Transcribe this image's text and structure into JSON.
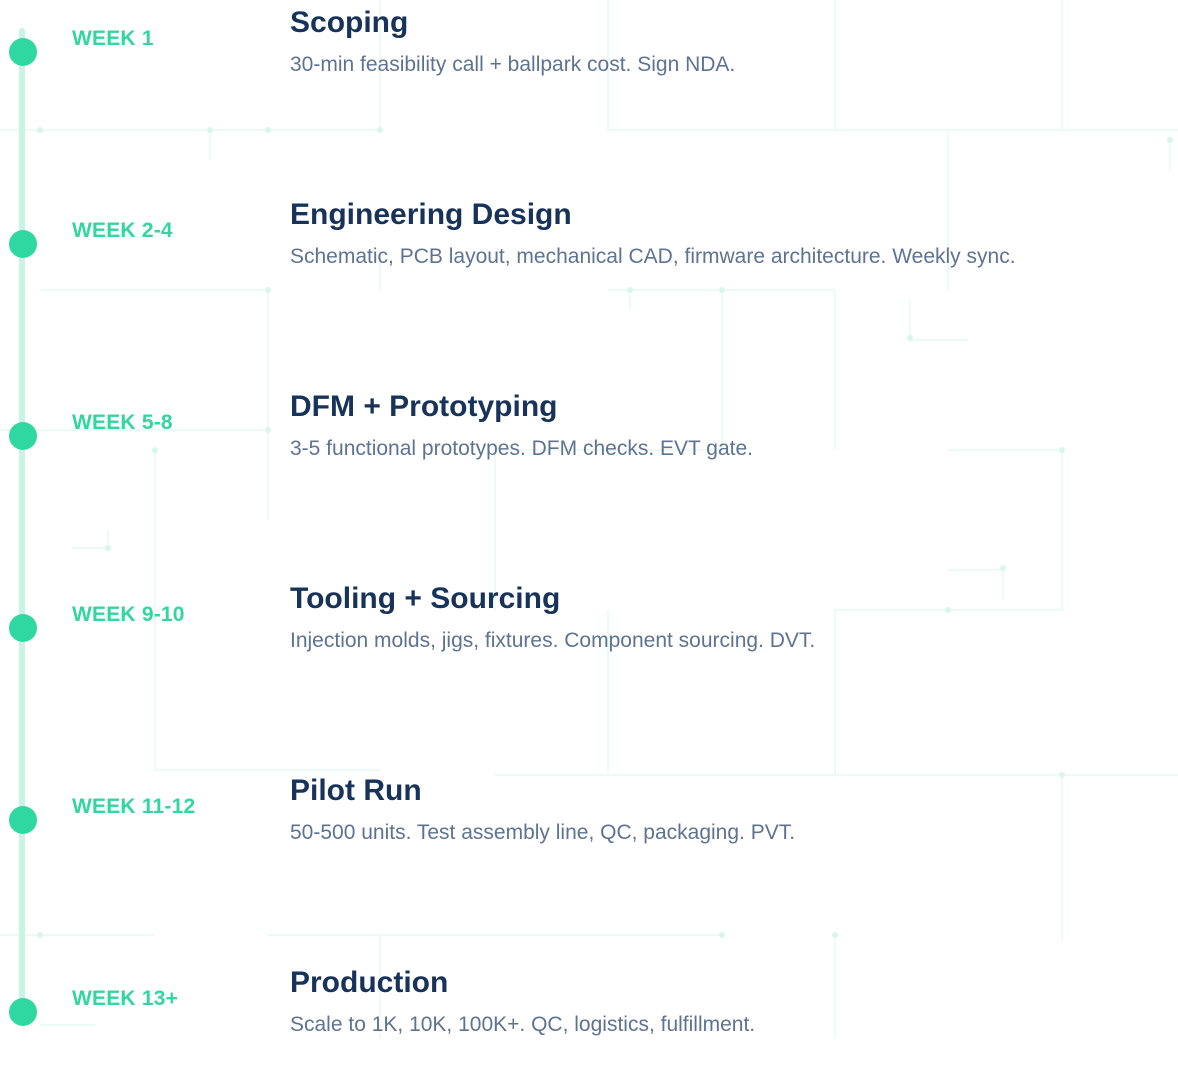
{
  "colors": {
    "accent": "#2fd8a0",
    "week_label": "#34d69f",
    "title": "#18335a",
    "description": "#5f7391",
    "rail": "#c9f3e3",
    "circuit_lines": "#e6faf2"
  },
  "timeline": {
    "steps": [
      {
        "week": "WEEK 1",
        "title": "Scoping",
        "description": "30-min feasibility call + ballpark cost. Sign NDA."
      },
      {
        "week": "WEEK 2-4",
        "title": "Engineering Design",
        "description": "Schematic, PCB layout, mechanical CAD, firmware architecture. Weekly sync."
      },
      {
        "week": "WEEK 5-8",
        "title": "DFM + Prototyping",
        "description": "3-5 functional prototypes. DFM checks. EVT gate."
      },
      {
        "week": "WEEK 9-10",
        "title": "Tooling + Sourcing",
        "description": "Injection molds, jigs, fixtures. Component sourcing. DVT."
      },
      {
        "week": "WEEK 11-12",
        "title": "Pilot Run",
        "description": "50-500 units. Test assembly line, QC, packaging. PVT."
      },
      {
        "week": "WEEK 13+",
        "title": "Production",
        "description": "Scale to 1K, 10K, 100K+. QC, logistics, fulfillment."
      }
    ]
  }
}
